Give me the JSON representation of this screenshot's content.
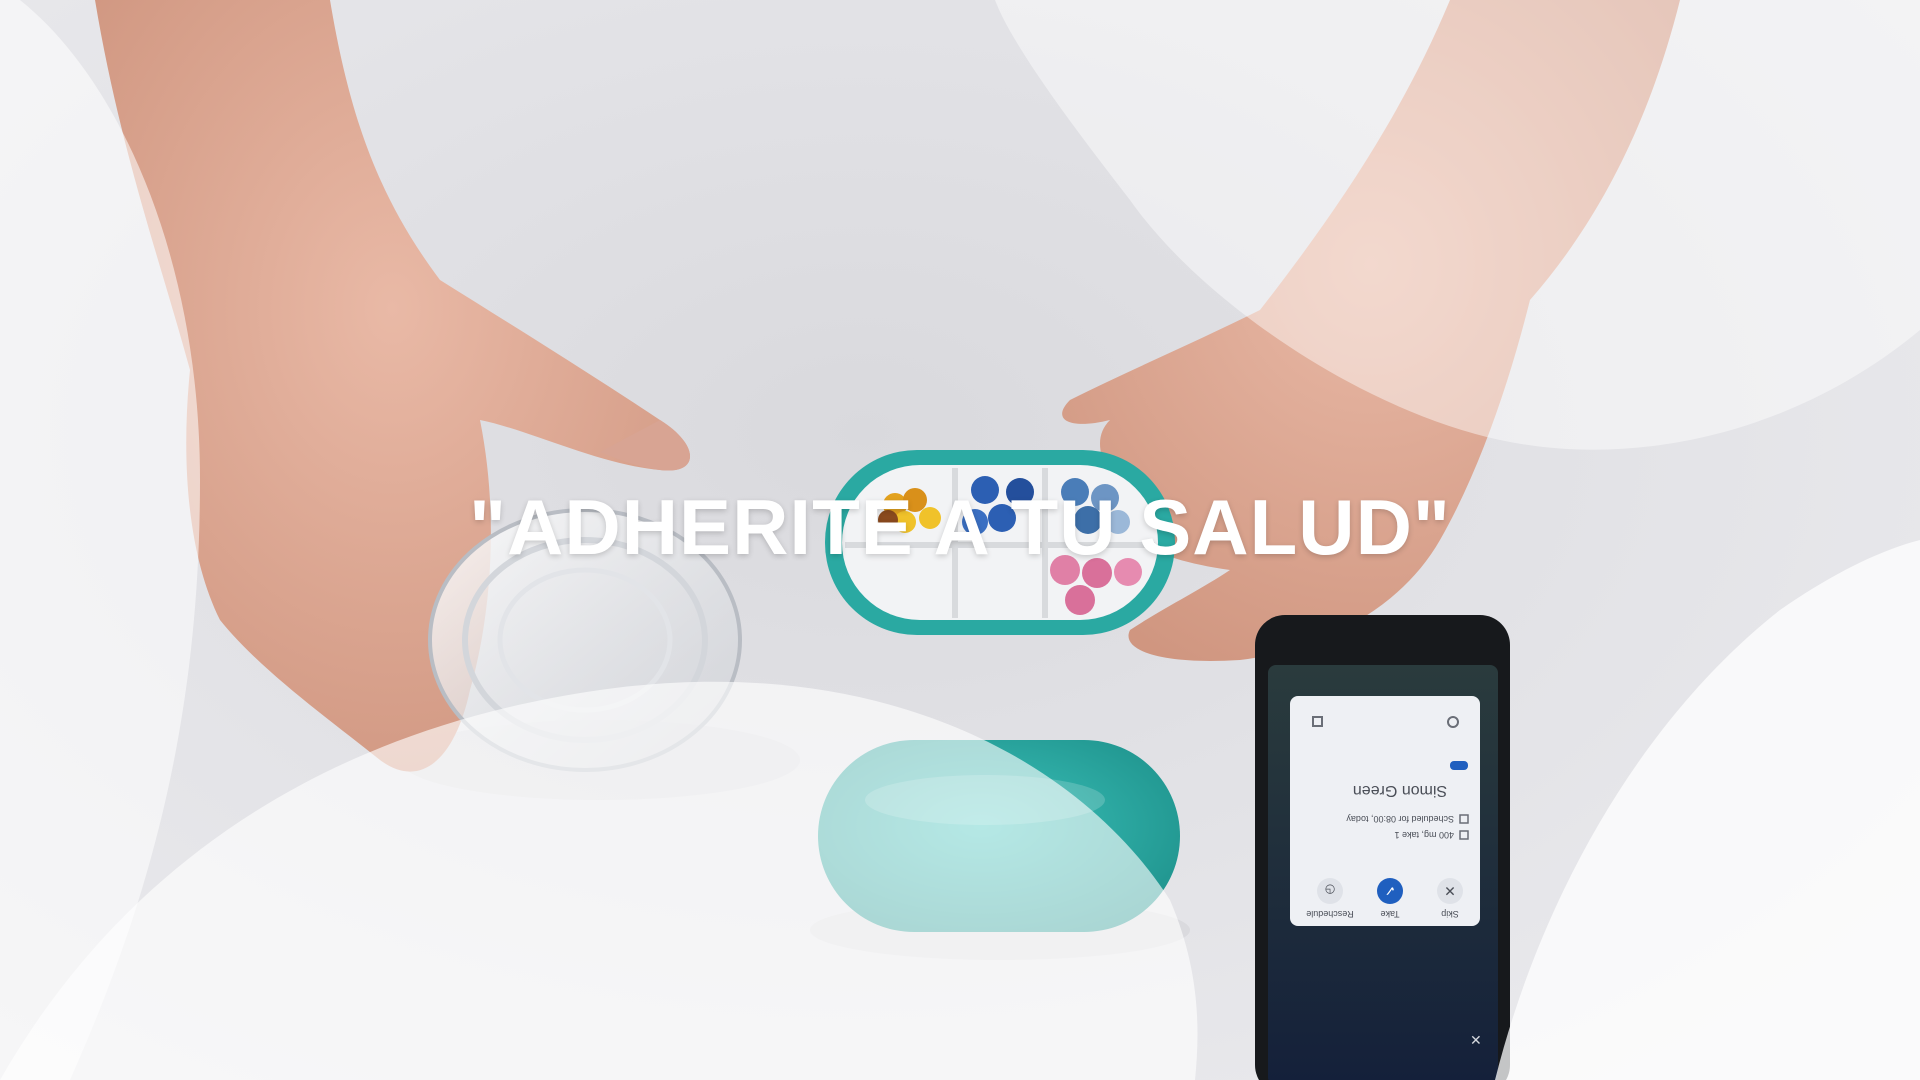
{
  "headline": "\"ADHERITE A TU SALUD\"",
  "phone": {
    "actions": [
      "Skip",
      "Take",
      "Reschedule"
    ],
    "patient_name": "Simon Green",
    "schedule_text": "Scheduled for 08:00, today",
    "dose_text": "400 mg, take 1",
    "accent_color": "#1f5fbf"
  },
  "colors": {
    "pillbox_teal": "#2aa9a2",
    "background": "#e4e4e7"
  }
}
